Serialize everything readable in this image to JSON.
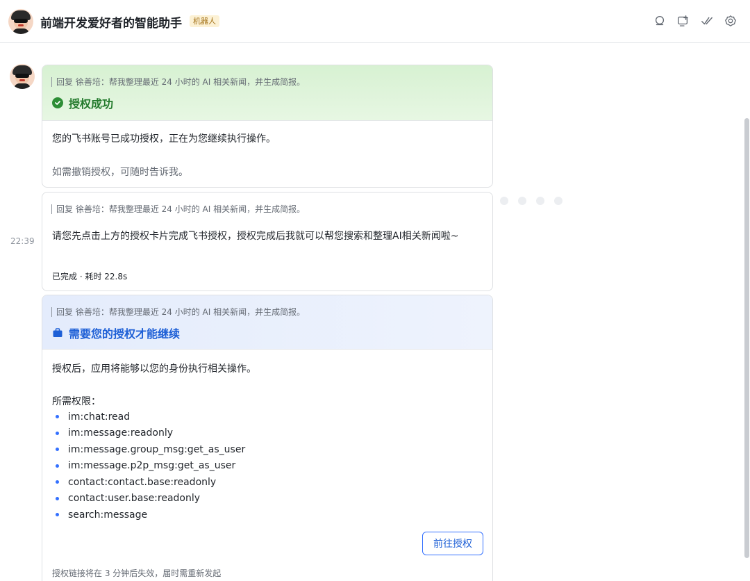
{
  "header": {
    "title": "前端开发爱好者的智能助手",
    "badge": "机器人",
    "icons": [
      "search-chat-icon",
      "add-to-screen-icon",
      "check-done-icon",
      "settings-gear-icon"
    ]
  },
  "messages": {
    "time": "22:39",
    "card1": {
      "reply": "回复 徐善培：帮我整理最近 24 小时的 AI 相关新闻，并生成简报。",
      "title": "授权成功",
      "body": "您的飞书账号已成功授权，正在为您继续执行操作。",
      "note": "如需撤销授权，可随时告诉我。",
      "accent": "#237a2c"
    },
    "card2": {
      "reply": "回复 徐善培：帮我整理最近 24 小时的 AI 相关新闻，并生成简报。",
      "body": "请您先点击上方的授权卡片完成飞书授权，授权完成后我就可以帮您搜索和整理AI相关新闻啦~",
      "status": "已完成 · 耗时 22.8s"
    },
    "card3": {
      "reply": "回复 徐善培：帮我整理最近 24 小时的 AI 相关新闻，并生成简报。",
      "title": "需要您的授权才能继续",
      "desc": "授权后，应用将能够以您的身份执行相关操作。",
      "perm_title": "所需权限：",
      "permissions": [
        "im:chat:read",
        "im:message:readonly",
        "im:message.group_msg:get_as_user",
        "im:message.p2p_msg:get_as_user",
        "contact:contact.base:readonly",
        "contact:user.base:readonly",
        "search:message"
      ],
      "button": "前往授权",
      "expire": "授权链接将在 3 分钟后失效，届时需重新发起",
      "accent": "#1d5fd6"
    }
  }
}
